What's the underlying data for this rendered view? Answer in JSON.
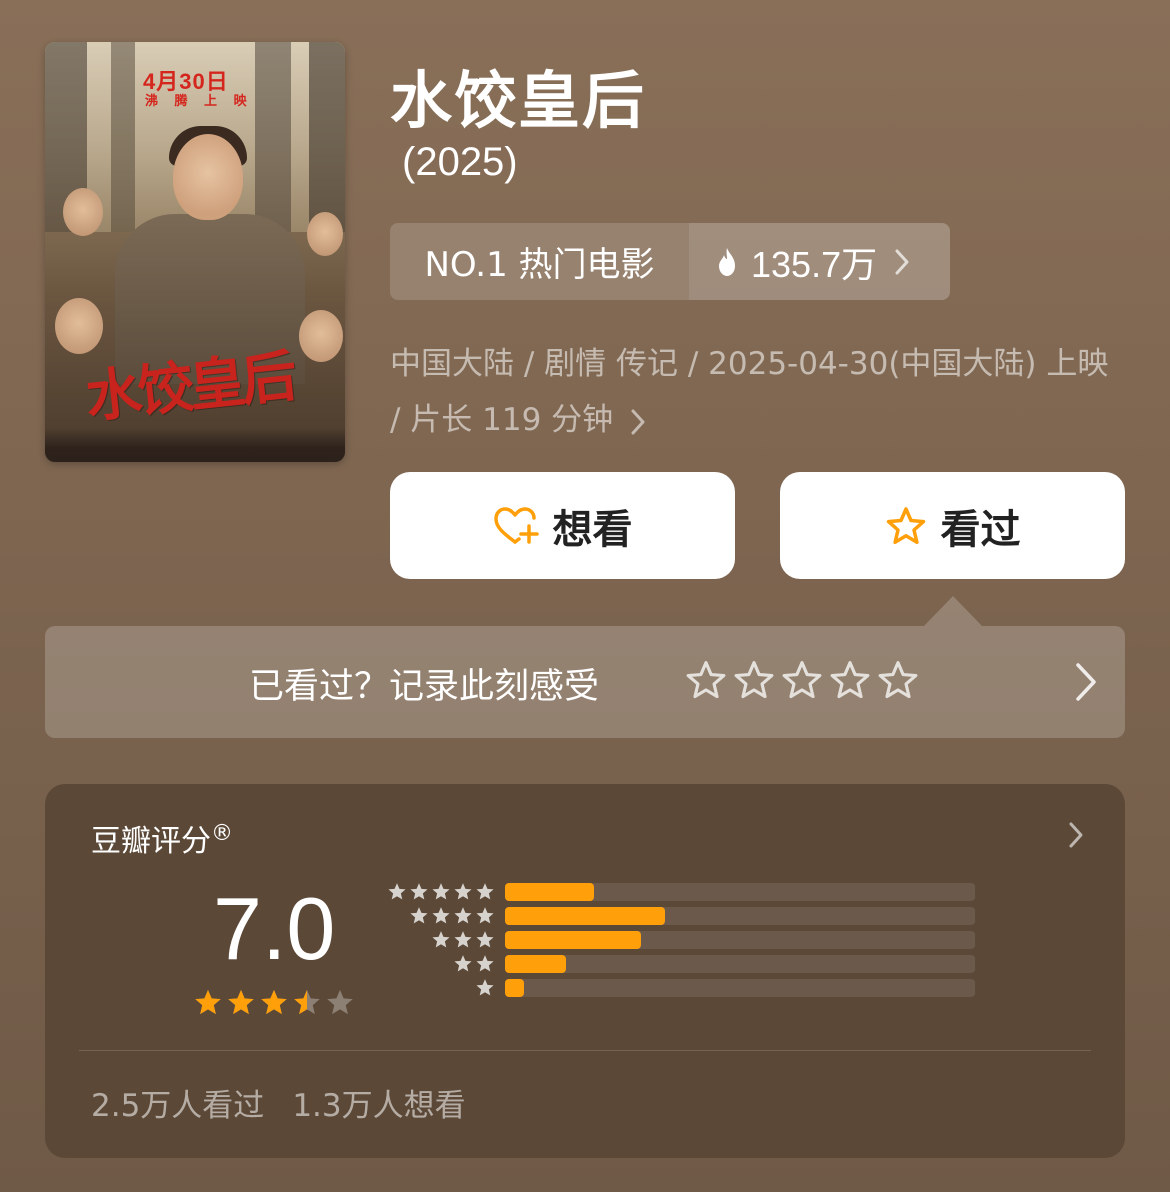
{
  "movie": {
    "title": "水饺皇后",
    "year": "(2025)",
    "poster": {
      "date": "4月30日",
      "tagline": "沸 腾 上 映",
      "title_art": "水饺皇后"
    },
    "rank": {
      "label": "NO.1 热门电影",
      "heat": "135.7万",
      "icon": "fire-icon"
    },
    "meta": "中国大陆 / 剧情 传记 / 2025-04-30(中国大陆) 上映 / 片长 119 分钟"
  },
  "actions": {
    "want_label": "想看",
    "want_icon": "heart-plus-icon",
    "seen_label": "看过",
    "seen_icon": "star-icon"
  },
  "rate_prompt": {
    "text": "已看过？记录此刻感受",
    "star_count": 5
  },
  "rating": {
    "label": "豆瓣评分",
    "registered_mark": "®",
    "score": "7.0",
    "stars": 3.5,
    "max_stars": 5,
    "distribution": [
      {
        "stars": 5,
        "fraction": 0.19
      },
      {
        "stars": 4,
        "fraction": 0.34
      },
      {
        "stars": 3,
        "fraction": 0.29
      },
      {
        "stars": 2,
        "fraction": 0.13
      },
      {
        "stars": 1,
        "fraction": 0.04
      }
    ],
    "seen_count": "2.5万人看过",
    "want_count": "1.3万人想看"
  },
  "colors": {
    "accent": "#ff9f0a",
    "background": "#7d6550",
    "card": "#5b4837",
    "poster_red": "#d5261e"
  }
}
